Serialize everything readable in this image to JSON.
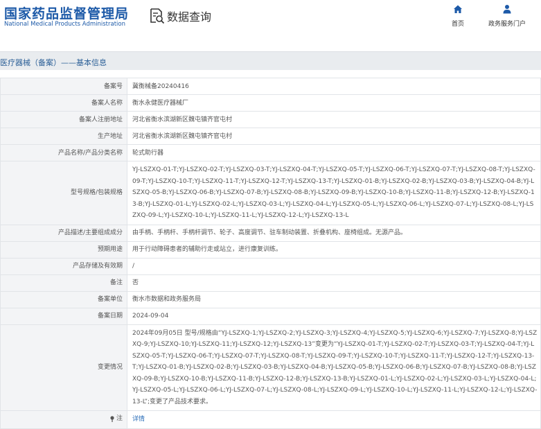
{
  "header": {
    "logo_cn": "国家药品监督管理局",
    "logo_en": "National Medical Products Administration",
    "page_title": "数据查询",
    "nav": {
      "home": "首页",
      "portal": "政务服务门户"
    }
  },
  "section": {
    "title": "医疗器械（备案）——基本信息"
  },
  "details": {
    "filing_no": {
      "label": "备案号",
      "value": "冀衡械备20240416"
    },
    "filer_name": {
      "label": "备案人名称",
      "value": "衡水永健医疗器械厂"
    },
    "filer_address": {
      "label": "备案人注册地址",
      "value": "河北省衡水滨湖新区魏屯镇齐官屯村"
    },
    "production_address": {
      "label": "生产地址",
      "value": "河北省衡水滨湖新区魏屯镇齐官屯村"
    },
    "product_name": {
      "label": "产品名称/产品分类名称",
      "value": "轮式助行器"
    },
    "model_spec": {
      "label": "型号规格/包装规格",
      "value": "YJ-LSZXQ-01-T;YJ-LSZXQ-02-T;YJ-LSZXQ-03-T;YJ-LSZXQ-04-T;YJ-LSZXQ-05-T;YJ-LSZXQ-06-T;YJ-LSZXQ-07-T;YJ-LSZXQ-08-T;YJ-LSZXQ-09-T;YJ-LSZXQ-10-T;YJ-LSZXQ-11-T;YJ-LSZXQ-12-T;YJ-LSZXQ-13-T;YJ-LSZXQ-01-B;YJ-LSZXQ-02-B;YJ-LSZXQ-03-B;YJ-LSZXQ-04-B;YJ-LSZXQ-05-B;YJ-LSZXQ-06-B;YJ-LSZXQ-07-B;YJ-LSZXQ-08-B;YJ-LSZXQ-09-B;YJ-LSZXQ-10-B;YJ-LSZXQ-11-B;YJ-LSZXQ-12-B;YJ-LSZXQ-13-B;YJ-LSZXQ-01-L;YJ-LSZXQ-02-L;YJ-LSZXQ-03-L;YJ-LSZXQ-04-L;YJ-LSZXQ-05-L;YJ-LSZXQ-06-L;YJ-LSZXQ-07-L;YJ-LSZXQ-08-L;YJ-LSZXQ-09-L;YJ-LSZXQ-10-L;YJ-LSZXQ-11-L;YJ-LSZXQ-12-L;YJ-LSZXQ-13-L"
    },
    "description": {
      "label": "产品描述/主要组成成分",
      "value": "由手柄、手柄杆、手柄杆调节、轮子、高度调节、驻车制动装置、折叠机构、座椅组成。无源产品。"
    },
    "intended_use": {
      "label": "预期用途",
      "value": "用于行动障碍患者的辅助行走或站立，进行康复训练。"
    },
    "storage": {
      "label": "产品存储及有效期",
      "value": "/"
    },
    "remark": {
      "label": "备注",
      "value": "否"
    },
    "filing_unit": {
      "label": "备案单位",
      "value": "衡水市数据和政务服务局"
    },
    "filing_date": {
      "label": "备案日期",
      "value": "2024-09-04"
    },
    "change": {
      "label": "变更情况",
      "value": "2024年09月05日 型号/规格由“YJ-LSZXQ-1;YJ-LSZXQ-2;YJ-LSZXQ-3;YJ-LSZXQ-4;YJ-LSZXQ-5;YJ-LSZXQ-6;YJ-LSZXQ-7;YJ-LSZXQ-8;YJ-LSZXQ-9;YJ-LSZXQ-10;YJ-LSZXQ-11;YJ-LSZXQ-12;YJ-LSZXQ-13”变更为“YJ-LSZXQ-01-T;YJ-LSZXQ-02-T;YJ-LSZXQ-03-T;YJ-LSZXQ-04-T;YJ-LSZXQ-05-T;YJ-LSZXQ-06-T;YJ-LSZXQ-07-T;YJ-LSZXQ-08-T;YJ-LSZXQ-09-T;YJ-LSZXQ-10-T;YJ-LSZXQ-11-T;YJ-LSZXQ-12-T;YJ-LSZXQ-13-T;YJ-LSZXQ-01-B;YJ-LSZXQ-02-B;YJ-LSZXQ-03-B;YJ-LSZXQ-04-B;YJ-LSZXQ-05-B;YJ-LSZXQ-06-B;YJ-LSZXQ-07-B;YJ-LSZXQ-08-B;YJ-LSZXQ-09-B;YJ-LSZXQ-10-B;YJ-LSZXQ-11-B;YJ-LSZXQ-12-B;YJ-LSZXQ-13-B;YJ-LSZXQ-01-L;YJ-LSZXQ-02-L;YJ-LSZXQ-03-L;YJ-LSZXQ-04-L;YJ-LSZXQ-05-L;YJ-LSZXQ-06-L;YJ-LSZXQ-07-L;YJ-LSZXQ-08-L;YJ-LSZXQ-09-L;YJ-LSZXQ-10-L;YJ-LSZXQ-11-L;YJ-LSZXQ-12-L;YJ-LSZXQ-13-L”;变更了产品技术要求。"
    },
    "note": {
      "label": "注",
      "value": "详情"
    }
  },
  "colors": {
    "brand": "#1d5aa8",
    "link": "#2a6db8",
    "label_bg": "#f3f4f6",
    "section_bg": "#e9ecef"
  },
  "icons": {
    "page_title": "search-doc-icon",
    "home": "home-icon",
    "portal": "user-icon",
    "note": "pin-icon"
  }
}
